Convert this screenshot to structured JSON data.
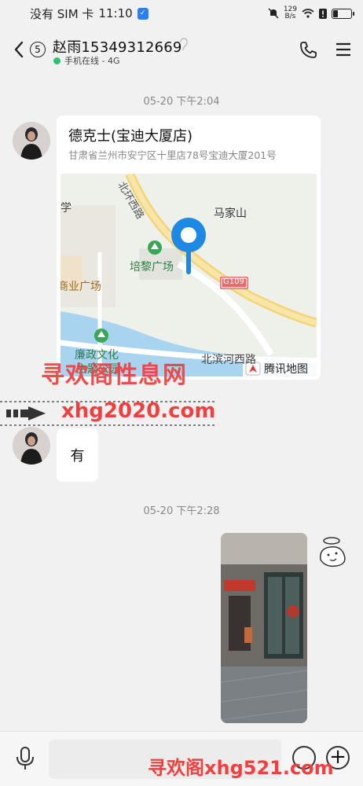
{
  "status_bar": {
    "carrier": "没有 SIM 卡",
    "time": "11:10",
    "net_rate_top": "129",
    "net_rate_bottom": "B/s",
    "battery_level": 0.25
  },
  "header": {
    "back_icon": "chevron-left-icon",
    "unread_count": "5",
    "contact_name": "赵雨15349312669",
    "online_status": "手机在线 - 4G",
    "online_color": "#2fc26a"
  },
  "messages": [
    {
      "timestamp": "05-20 下午2:04",
      "type": "location",
      "title": "德克士(宝迪大厦店)",
      "address": "甘肃省兰州市安宁区十里店78号宝迪大厦201号",
      "map": {
        "labels": {
          "road_north": "北环西路",
          "majiashan": "马家山",
          "xue": "学",
          "peili": "培黎广场",
          "shangye": "商业广场",
          "g109": "G109",
          "lianzheng1": "廉政文化",
          "lianzheng2": "主题公园",
          "beibin": "北滨河西路",
          "provider": "腾讯地图"
        }
      }
    },
    {
      "type": "text",
      "text": "有"
    },
    {
      "timestamp": "05-20 下午2:28",
      "type": "image"
    }
  ],
  "watermarks": {
    "w1": "寻欢阁性息网",
    "w2": "xhg2020.com",
    "w3": "寻欢阁xhg521.com"
  },
  "colors": {
    "accent_blue": "#1e88e5",
    "watermark_red": "#ef3f3f"
  }
}
